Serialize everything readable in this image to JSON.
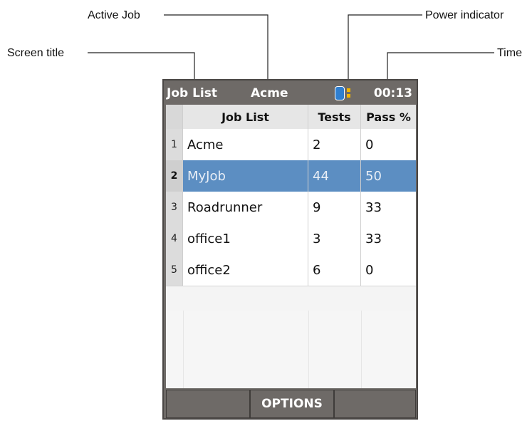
{
  "callouts": {
    "active_job": "Active Job",
    "power_indicator": "Power indicator",
    "screen_title": "Screen title",
    "time": "Time"
  },
  "status_bar": {
    "title": "Job List",
    "active_job": "Acme",
    "time": "00:13",
    "power_icon": "battery-power-icon"
  },
  "table": {
    "headers": {
      "num": "",
      "name": "Job List",
      "tests": "Tests",
      "pass": "Pass %"
    },
    "rows": [
      {
        "num": "1",
        "name": "Acme",
        "tests": "2",
        "pass": "0",
        "selected": false
      },
      {
        "num": "2",
        "name": "MyJob",
        "tests": "44",
        "pass": "50",
        "selected": true
      },
      {
        "num": "3",
        "name": "Roadrunner",
        "tests": "9",
        "pass": "33",
        "selected": false
      },
      {
        "num": "4",
        "name": "office1",
        "tests": "3",
        "pass": "33",
        "selected": false
      },
      {
        "num": "5",
        "name": "office2",
        "tests": "6",
        "pass": "0",
        "selected": false
      }
    ]
  },
  "softkeys": {
    "left": "",
    "middle": "OPTIONS",
    "right": ""
  },
  "colors": {
    "selected_row": "#5c8ec2",
    "device_frame": "#6e6a67",
    "power_icon": "#2f7fd0",
    "power_dots": "#f2b600"
  }
}
